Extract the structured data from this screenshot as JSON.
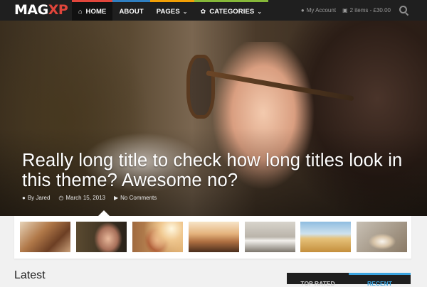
{
  "logo": {
    "part1": "MAG",
    "part2": "XP"
  },
  "nav": {
    "items": [
      {
        "label": "HOME",
        "icon": "home-icon",
        "accent": "#e1453b",
        "active": true
      },
      {
        "label": "ABOUT",
        "icon": "",
        "accent": "#2f7fc1",
        "active": false
      },
      {
        "label": "PAGES",
        "icon": "",
        "accent": "#f29f05",
        "active": false,
        "caret": true
      },
      {
        "label": "CATEGORIES",
        "icon": "leaf-icon",
        "accent": "#86b839",
        "active": false,
        "caret": true
      }
    ]
  },
  "header_right": {
    "account_label": "My Account",
    "cart_label": "2 items - £30.00",
    "account_icon": "user-icon",
    "cart_icon": "cart-icon",
    "search_icon": "search-icon"
  },
  "hero": {
    "title": "Really long title to check how long titles look in this theme? Awesome no?",
    "author": "By Jared",
    "date": "March 15, 2013",
    "comments": "No Comments"
  },
  "thumbnails": [
    {
      "name": "building-thumbnail"
    },
    {
      "name": "woman-glasses-thumbnail"
    },
    {
      "name": "woman-sunlight-thumbnail"
    },
    {
      "name": "pier-sunset-thumbnail"
    },
    {
      "name": "desk-workspace-thumbnail"
    },
    {
      "name": "wheat-field-thumbnail"
    },
    {
      "name": "cake-plate-thumbnail"
    }
  ],
  "latest_heading": "Latest",
  "sidebar_tabs": [
    {
      "label": "TOP RATED",
      "active": false
    },
    {
      "label": "RECENT",
      "active": true
    }
  ],
  "colors": {
    "topbar": "#1f1f1f",
    "logo_accent": "#e1453b",
    "recent_tab_accent": "#3ba4e0"
  }
}
